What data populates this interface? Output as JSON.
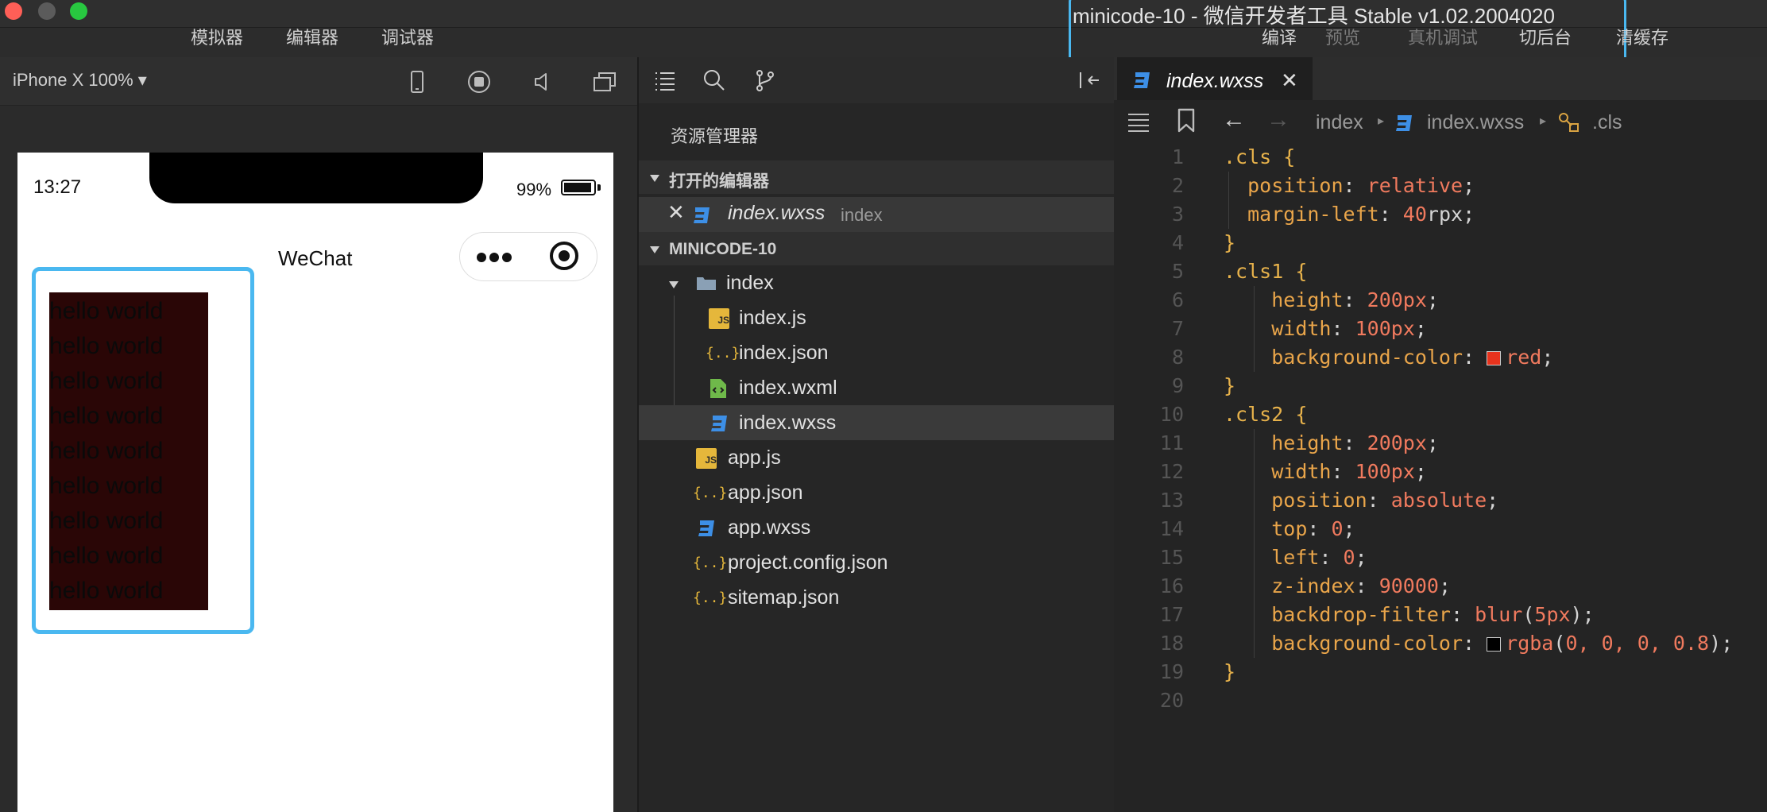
{
  "window": {
    "title": "minicode-10 - 微信开发者工具 Stable v1.02.2004020",
    "toolbar_left": [
      "模拟器",
      "编辑器",
      "调试器"
    ],
    "toolbar_right": [
      "编译",
      "预览",
      "真机调试",
      "切后台",
      "清缓存"
    ],
    "traffic_colors": [
      "#ff5f57",
      "#5b5b5b",
      "#28c840"
    ],
    "highlight_color": "#4ab8f0"
  },
  "simulator": {
    "device": "iPhone X 100% ▾",
    "icons": [
      "phone-icon",
      "record-icon",
      "speaker-icon",
      "window-icon"
    ],
    "status": {
      "time": "13:27",
      "battery": "99%"
    },
    "nav_title": "WeChat",
    "capsule_icons": [
      "more-dots-icon",
      "target-icon"
    ],
    "hello_lines": [
      "hello world",
      "hello world",
      "hello world",
      "hello world",
      "hello world",
      "hello world",
      "hello world",
      "hello world",
      "hello world"
    ],
    "cls1_color": "#2a0606"
  },
  "explorer": {
    "icons": [
      "list-icon",
      "search-icon",
      "branch-icon",
      "collapse-panel-icon"
    ],
    "title": "资源管理器",
    "open_editors_label": "打开的编辑器",
    "open_file": {
      "name": "index.wxss",
      "folder": "index"
    },
    "project_label": "MINICODE-10",
    "folder": "index",
    "folder_files": [
      {
        "name": "index.js",
        "icon": "js-icon"
      },
      {
        "name": "index.json",
        "icon": "json-icon"
      },
      {
        "name": "index.wxml",
        "icon": "wxml-icon"
      },
      {
        "name": "index.wxss",
        "icon": "css-icon"
      }
    ],
    "root_files": [
      {
        "name": "app.js",
        "icon": "js-icon"
      },
      {
        "name": "app.json",
        "icon": "json-icon"
      },
      {
        "name": "app.wxss",
        "icon": "css-icon"
      },
      {
        "name": "project.config.json",
        "icon": "json-icon"
      },
      {
        "name": "sitemap.json",
        "icon": "json-icon"
      }
    ],
    "json_glyph": "{..}",
    "js_glyph": "JS"
  },
  "editor": {
    "tab": "index.wxss",
    "tab_close": "✕",
    "breadcrumb": [
      "index",
      "index.wxss",
      ".cls"
    ],
    "line_numbers": [
      "1",
      "2",
      "3",
      "4",
      "5",
      "6",
      "7",
      "8",
      "9",
      "10",
      "11",
      "12",
      "13",
      "14",
      "15",
      "16",
      "17",
      "18",
      "19",
      "20"
    ],
    "code": {
      "l1_sel": ".cls",
      "l2_prop": "position",
      "l2_val": "relative",
      "l3_prop": "margin-left",
      "l3_num": "40",
      "l3_unit": "rpx",
      "l5_sel": ".cls1",
      "l6_prop": "height",
      "l6_val": "200px",
      "l7_prop": "width",
      "l7_val": "100px",
      "l8_prop": "background-color",
      "l8_val": "red",
      "l8_swatch": "#e8331d",
      "l10_sel": ".cls2",
      "l11_prop": "height",
      "l11_val": "200px",
      "l12_prop": "width",
      "l12_val": "100px",
      "l13_prop": "position",
      "l13_val": "absolute",
      "l14_prop": "top",
      "l14_val": "0",
      "l15_prop": "left",
      "l15_val": "0",
      "l16_prop": "z-index",
      "l16_val": "90000",
      "l17_prop": "backdrop-filter",
      "l17_fn": "blur",
      "l17_arg": "5px",
      "l18_prop": "background-color",
      "l18_fn": "rgba",
      "l18_args": "0, 0, 0, 0.8",
      "l18_swatch": "#000000"
    }
  }
}
